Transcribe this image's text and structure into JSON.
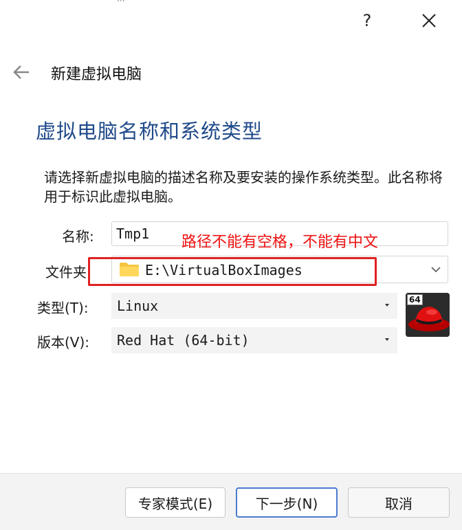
{
  "window": {
    "top_fragment": "iii",
    "help_label": "?",
    "close_icon": "close-icon"
  },
  "nav": {
    "back_icon": "arrow-left-icon",
    "title": "新建虚拟电脑"
  },
  "section": {
    "title": "虚拟电脑名称和系统类型",
    "description": "请选择新虚拟电脑的描述名称及要安装的操作系统类型。此名称将用于标识此虚拟电脑。"
  },
  "form": {
    "name_label": "名称:",
    "name_value": "Tmp1",
    "folder_label": "文件夹:",
    "folder_value": "E:\\VirtualBoxImages",
    "type_label": "类型(T):",
    "type_value": "Linux",
    "version_label": "版本(V):",
    "version_value": "Red Hat (64-bit)",
    "os_badge": "64"
  },
  "annotation": {
    "text": "路径不能有空格，不能有中文",
    "color": "#e02020"
  },
  "footer": {
    "expert_label": "专家模式(E)",
    "next_label": "下一步(N)",
    "cancel_label": "取消"
  },
  "colors": {
    "section_title": "#1f4a8a",
    "accent_border": "#4a7ad0"
  }
}
